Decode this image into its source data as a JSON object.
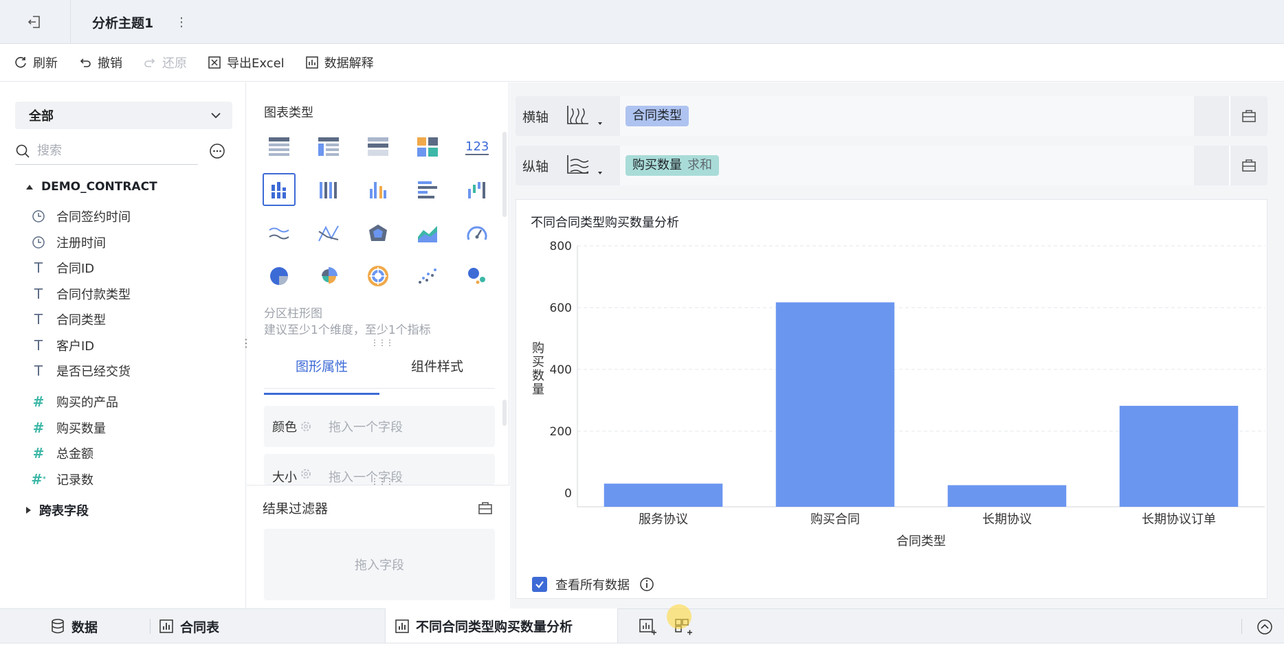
{
  "topbar": {
    "title": "分析主题1",
    "more": "⋮"
  },
  "toolbar": {
    "refresh": "刷新",
    "undo": "撤销",
    "redo": "还原",
    "export": "导出Excel",
    "explain": "数据解释"
  },
  "left": {
    "scope": "全部",
    "search_placeholder": "搜索",
    "table_name": "DEMO_CONTRACT",
    "fields": [
      {
        "label": "合同签约时间",
        "type": "date"
      },
      {
        "label": "注册时间",
        "type": "date"
      },
      {
        "label": "合同ID",
        "type": "text"
      },
      {
        "label": "合同付款类型",
        "type": "text"
      },
      {
        "label": "合同类型",
        "type": "text"
      },
      {
        "label": "客户ID",
        "type": "text"
      },
      {
        "label": "是否已经交货",
        "type": "text"
      },
      {
        "label": "购买的产品",
        "type": "number"
      },
      {
        "label": "购买数量",
        "type": "number"
      },
      {
        "label": "总金额",
        "type": "number"
      },
      {
        "label": "记录数",
        "type": "number"
      }
    ],
    "cross_fields": "跨表字段"
  },
  "middle": {
    "chart_type_label": "图表类型",
    "selected_chart_name": "分区柱形图",
    "selected_chart_hint": "建议至少1个维度，至少1个指标",
    "tabs": [
      "图形属性",
      "组件样式"
    ],
    "props": [
      {
        "label": "颜色",
        "hint": "拖入一个字段"
      },
      {
        "label": "大小",
        "hint": "拖入一个字段"
      }
    ],
    "filter_label": "结果过滤器",
    "filter_drop": "拖入字段"
  },
  "axes": {
    "x_label": "横轴",
    "x_field": "合同类型",
    "y_label": "纵轴",
    "y_field": "购买数量",
    "y_agg": "求和"
  },
  "colors": {
    "accent": "#3d6bd6",
    "bar": "#6b96f0",
    "x_pill": "#aec3f0",
    "y_pill": "#a9dcd8"
  },
  "chart": {
    "title": "不同合同类型购买数量分析",
    "view_all": "查看所有数据"
  },
  "chart_data": {
    "type": "bar",
    "title": "不同合同类型购买数量分析",
    "categories": [
      "服务协议",
      "购买合同",
      "长期协议",
      "长期协议订单"
    ],
    "values": [
      30,
      617,
      25,
      282
    ],
    "xlabel": "合同类型",
    "ylabel": "购买数量",
    "yticks": [
      0,
      200,
      400,
      600,
      800
    ],
    "ylim": [
      -45,
      800
    ],
    "grid": true
  },
  "bottom_tabs": {
    "data": "数据",
    "table": "合同表",
    "active": "不同合同类型购买数量分析"
  }
}
